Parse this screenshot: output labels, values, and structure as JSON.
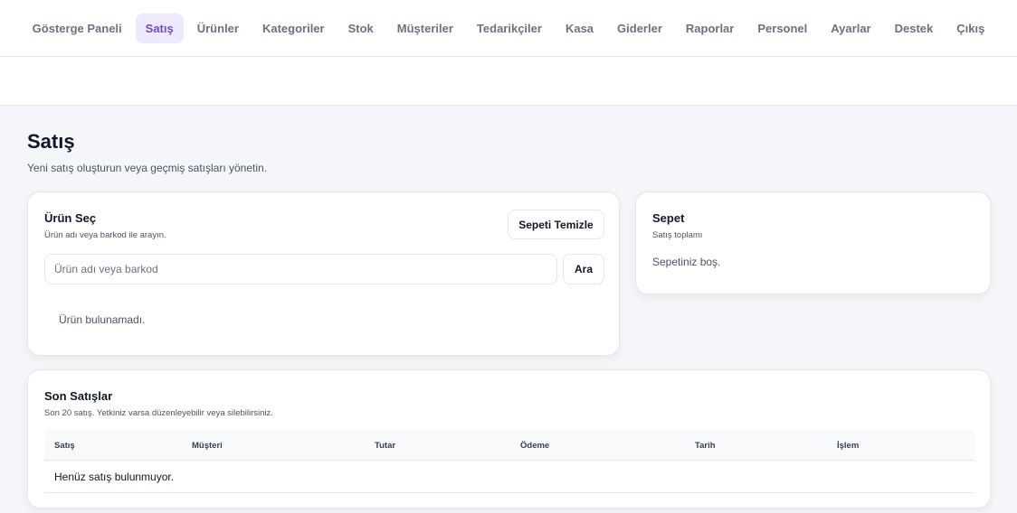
{
  "nav": {
    "items": [
      {
        "label": "Gösterge Paneli",
        "active": false
      },
      {
        "label": "Satış",
        "active": true
      },
      {
        "label": "Ürünler",
        "active": false
      },
      {
        "label": "Kategoriler",
        "active": false
      },
      {
        "label": "Stok",
        "active": false
      },
      {
        "label": "Müşteriler",
        "active": false
      },
      {
        "label": "Tedarikçiler",
        "active": false
      },
      {
        "label": "Kasa",
        "active": false
      },
      {
        "label": "Giderler",
        "active": false
      },
      {
        "label": "Raporlar",
        "active": false
      },
      {
        "label": "Personel",
        "active": false
      },
      {
        "label": "Ayarlar",
        "active": false
      },
      {
        "label": "Destek",
        "active": false
      },
      {
        "label": "Çıkış",
        "active": false
      }
    ]
  },
  "page": {
    "title": "Satış",
    "subtitle": "Yeni satış oluşturun veya geçmiş satışları yönetin."
  },
  "product_select": {
    "title": "Ürün Seç",
    "subtitle": "Ürün adı veya barkod ile arayın.",
    "clear_cart_label": "Sepeti Temizle",
    "search_placeholder": "Ürün adı veya barkod",
    "search_value": "",
    "search_button_label": "Ara",
    "empty_message": "Ürün bulunamadı."
  },
  "cart": {
    "title": "Sepet",
    "subtitle": "Satış toplamı",
    "empty_message": "Sepetiniz boş."
  },
  "recent_sales": {
    "title": "Son Satışlar",
    "subtitle": "Son 20 satış. Yetkiniz varsa düzenleyebilir veya silebilirsiniz.",
    "columns": [
      "Satış",
      "Müşteri",
      "Tutar",
      "Ödeme",
      "Tarih",
      "İşlem"
    ],
    "empty_message": "Henüz satış bulunmuyor."
  },
  "colors": {
    "accent": "#6d4fc7",
    "accent_bg": "#ede9fe",
    "page_bg": "#f4f6f9"
  }
}
